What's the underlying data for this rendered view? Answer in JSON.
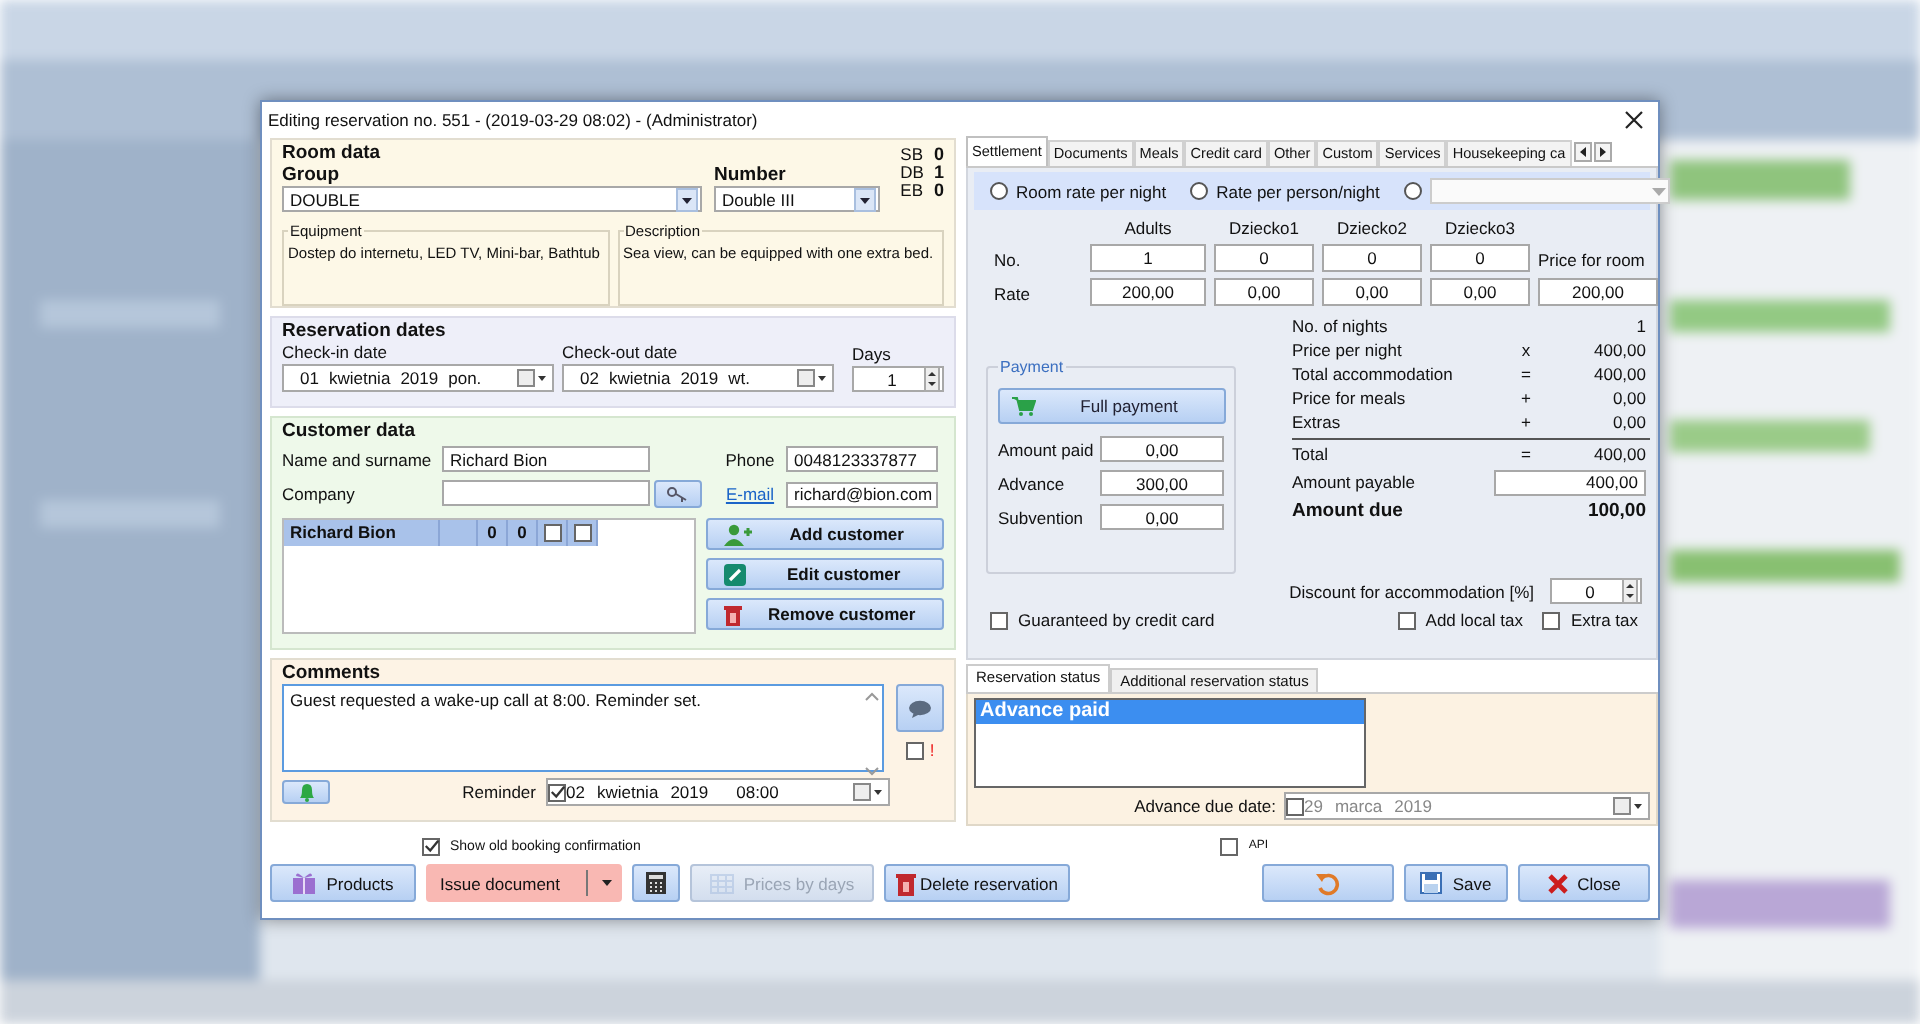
{
  "window": {
    "title": "Editing reservation no. 551 - (2019-03-29 08:02) - (Administrator)"
  },
  "room_data": {
    "heading": "Room data",
    "group_label": "Group",
    "group": "DOUBLE",
    "number_label": "Number",
    "number": "Double III",
    "bed_counts": [
      {
        "label": "SB",
        "value": "0"
      },
      {
        "label": "DB",
        "value": "1"
      },
      {
        "label": "EB",
        "value": "0"
      }
    ],
    "equipment_label": "Equipment",
    "equipment": "Dostep do internetu, LED TV, Mini-bar, Bathtub",
    "description_label": "Description",
    "description": "Sea view, can be equipped with one extra bed."
  },
  "reservation_dates": {
    "heading": "Reservation dates",
    "checkin_label": "Check-in date",
    "checkin": {
      "day": "01",
      "month": "kwietnia",
      "year": "2019",
      "weekday": "pon."
    },
    "checkout_label": "Check-out date",
    "checkout": {
      "day": "02",
      "month": "kwietnia",
      "year": "2019",
      "weekday": "wt."
    },
    "days_label": "Days",
    "days": "1"
  },
  "customer_data": {
    "heading": "Customer data",
    "name_label": "Name and surname",
    "name": "Richard Bion",
    "company_label": "Company",
    "phone_label": "Phone",
    "phone": "0048123337877",
    "email_label": "E-mail",
    "email": "richard@bion.com",
    "guests": [
      {
        "name": "Richard Bion",
        "count_1": "0",
        "count_2": "0",
        "flag_1": false,
        "flag_2": false,
        "selected": true
      }
    ],
    "buttons": [
      {
        "kind": "add",
        "label": "Add customer"
      },
      {
        "kind": "edit",
        "label": "Edit customer"
      },
      {
        "kind": "remove",
        "label": "Remove customer"
      }
    ]
  },
  "comments": {
    "heading": "Comments",
    "text": "Guest requested a wake-up call at 8:00. Reminder set.",
    "important": false,
    "important_mark": "!",
    "reminder_label": "Reminder",
    "reminder": {
      "enabled": true,
      "day": "02",
      "month": "kwietnia",
      "year": "2019",
      "time": "08:00"
    }
  },
  "show_old_confirmation": {
    "label": "Show old booking confirmation",
    "checked": true
  },
  "api": {
    "label": "API",
    "checked": false
  },
  "footer_buttons": [
    {
      "kind": "products",
      "label": "Products",
      "disabled": false
    },
    {
      "kind": "issue",
      "label": "Issue document",
      "disabled": false
    },
    {
      "kind": "calculator",
      "disabled": false
    },
    {
      "kind": "prices",
      "label": "Prices by days",
      "disabled": true
    },
    {
      "kind": "delete",
      "label": "Delete reservation",
      "disabled": false
    },
    {
      "kind": "undo",
      "disabled": false
    },
    {
      "kind": "save",
      "label": "Save",
      "disabled": false
    },
    {
      "kind": "close",
      "label": "Close",
      "disabled": false
    }
  ],
  "tabs": [
    {
      "label": "Settlement",
      "selected": true
    },
    {
      "label": "Documents",
      "selected": false
    },
    {
      "label": "Meals",
      "selected": false
    },
    {
      "label": "Credit card",
      "selected": false
    },
    {
      "label": "Other",
      "selected": false
    },
    {
      "label": "Custom",
      "selected": false
    },
    {
      "label": "Services",
      "selected": false
    },
    {
      "label": "Housekeeping ca",
      "selected": false
    }
  ],
  "rate_modes": [
    {
      "kind": "label",
      "label": "Room rate per night",
      "selected": false
    },
    {
      "kind": "label",
      "label": "Rate per person/night",
      "selected": false
    },
    {
      "kind": "dropdown",
      "selected": false
    }
  ],
  "occupancy": {
    "columns": [
      "Adults",
      "Dziecko1",
      "Dziecko2",
      "Dziecko3"
    ],
    "no_label": "No.",
    "rate_label": "Rate",
    "numbers": [
      "1",
      "0",
      "0",
      "0"
    ],
    "rates": [
      "200,00",
      "0,00",
      "0,00",
      "0,00"
    ],
    "price_for_room_label": "Price for room",
    "price_for_room": "200,00"
  },
  "summary": [
    {
      "kind": "line",
      "label": "No. of nights",
      "value": "1"
    },
    {
      "kind": "line",
      "label": "Price per night",
      "op": "x",
      "value": "400,00"
    },
    {
      "kind": "line",
      "label": "Total accommodation",
      "op": "=",
      "value": "400,00"
    },
    {
      "kind": "line",
      "label": "Price for meals",
      "op": "+",
      "value": "0,00"
    },
    {
      "kind": "line",
      "label": "Extras",
      "op": "+",
      "value": "0,00"
    },
    {
      "kind": "total",
      "label": "Total",
      "op": "=",
      "value": "400,00"
    }
  ],
  "amount_payable": {
    "label": "Amount payable",
    "value": "400,00"
  },
  "amount_due": {
    "label": "Amount due",
    "value": "100,00"
  },
  "payment": {
    "heading": "Payment",
    "button": "Full payment",
    "fields": [
      {
        "label": "Amount paid",
        "value": "0,00"
      },
      {
        "label": "Advance",
        "value": "300,00"
      },
      {
        "label": "Subvention",
        "value": "0,00"
      }
    ]
  },
  "discount": {
    "label": "Discount for accommodation [%]",
    "value": "0"
  },
  "guaranteed": {
    "label": "Guaranteed by credit card",
    "checked": false
  },
  "taxes": [
    {
      "label": "Add local tax",
      "checked": false
    },
    {
      "label": "Extra tax",
      "checked": false
    }
  ],
  "status_tabs": [
    {
      "label": "Reservation status",
      "selected": true
    },
    {
      "label": "Additional reservation status",
      "selected": false
    }
  ],
  "statuses": [
    {
      "label": "Advance paid",
      "selected": true
    }
  ],
  "advance_due": {
    "label": "Advance due date:",
    "enabled": false,
    "day": "29",
    "month": "marca",
    "year": "2019"
  }
}
